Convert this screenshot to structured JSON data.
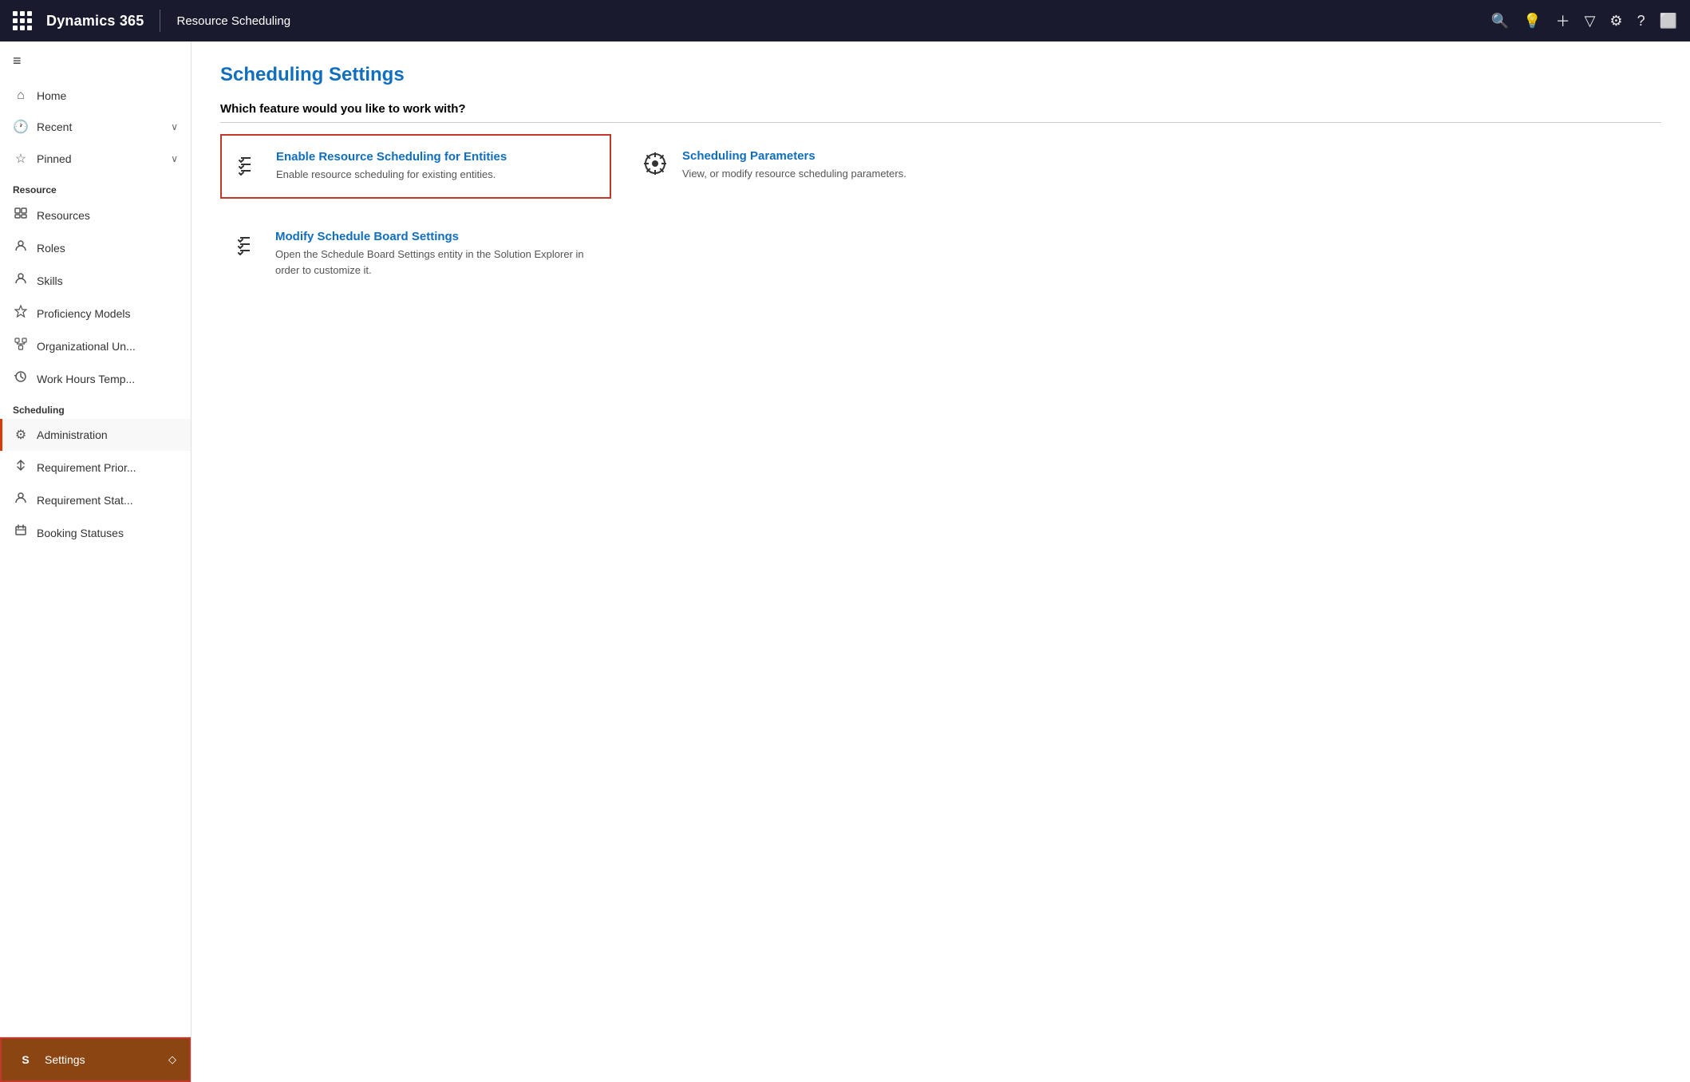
{
  "topbar": {
    "app_name": "Dynamics 365",
    "module_name": "Resource Scheduling"
  },
  "sidebar": {
    "hamburger_label": "≡",
    "nav_items_top": [
      {
        "id": "home",
        "icon": "⌂",
        "label": "Home",
        "has_chevron": false
      },
      {
        "id": "recent",
        "icon": "🕐",
        "label": "Recent",
        "has_chevron": true
      },
      {
        "id": "pinned",
        "icon": "☆",
        "label": "Pinned",
        "has_chevron": true
      }
    ],
    "section_resource": "Resource",
    "nav_items_resource": [
      {
        "id": "resources",
        "icon": "⊞",
        "label": "Resources",
        "has_chevron": false
      },
      {
        "id": "roles",
        "icon": "👤",
        "label": "Roles",
        "has_chevron": false
      },
      {
        "id": "skills",
        "icon": "👤",
        "label": "Skills",
        "has_chevron": false
      },
      {
        "id": "proficiency-models",
        "icon": "☆",
        "label": "Proficiency Models",
        "has_chevron": false
      },
      {
        "id": "organizational-units",
        "icon": "⊞",
        "label": "Organizational Un...",
        "has_chevron": false
      },
      {
        "id": "work-hours-temp",
        "icon": "⊙",
        "label": "Work Hours Temp...",
        "has_chevron": false
      }
    ],
    "section_scheduling": "Scheduling",
    "nav_items_scheduling": [
      {
        "id": "administration",
        "icon": "⚙",
        "label": "Administration",
        "active": true
      },
      {
        "id": "requirement-priorities",
        "icon": "↕",
        "label": "Requirement Prior...",
        "has_chevron": false
      },
      {
        "id": "requirement-statuses",
        "icon": "👤",
        "label": "Requirement Stat...",
        "has_chevron": false
      },
      {
        "id": "booking-statuses",
        "icon": "⊟",
        "label": "Booking Statuses",
        "has_chevron": false
      }
    ],
    "settings_label": "Settings",
    "settings_initial": "S",
    "settings_chevron": "◇"
  },
  "content": {
    "page_title": "Scheduling Settings",
    "section_question": "Which feature would you like to work with?",
    "cards": [
      {
        "id": "enable-resource-scheduling",
        "icon": "☰✓",
        "title": "Enable Resource Scheduling for Entities",
        "description": "Enable resource scheduling for existing entities.",
        "selected": true
      },
      {
        "id": "scheduling-parameters",
        "icon": "⚙",
        "title": "Scheduling Parameters",
        "description": "View, or modify resource scheduling parameters.",
        "selected": false
      },
      {
        "id": "modify-schedule-board",
        "icon": "☰✓",
        "title": "Modify Schedule Board Settings",
        "description": "Open the Schedule Board Settings entity in the Solution Explorer in order to customize it.",
        "selected": false
      }
    ]
  }
}
